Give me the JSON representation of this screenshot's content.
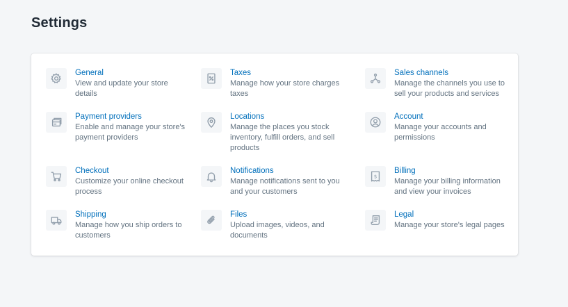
{
  "page": {
    "title": "Settings"
  },
  "settings": [
    {
      "key": "general",
      "title": "General",
      "description": "View and update your store details",
      "icon": "gear-icon"
    },
    {
      "key": "taxes",
      "title": "Taxes",
      "description": "Manage how your store charges taxes",
      "icon": "receipt-percent-icon"
    },
    {
      "key": "sales-channels",
      "title": "Sales channels",
      "description": "Manage the channels you use to sell your products and services",
      "icon": "channels-icon"
    },
    {
      "key": "payment-providers",
      "title": "Payment providers",
      "description": "Enable and manage your store's payment providers",
      "icon": "credit-card-icon"
    },
    {
      "key": "locations",
      "title": "Locations",
      "description": "Manage the places you stock inventory, fulfill orders, and sell products",
      "icon": "location-pin-icon"
    },
    {
      "key": "account",
      "title": "Account",
      "description": "Manage your accounts and permissions",
      "icon": "profile-icon"
    },
    {
      "key": "checkout",
      "title": "Checkout",
      "description": "Customize your online checkout process",
      "icon": "cart-icon"
    },
    {
      "key": "notifications",
      "title": "Notifications",
      "description": "Manage notifications sent to you and your customers",
      "icon": "bell-icon"
    },
    {
      "key": "billing",
      "title": "Billing",
      "description": "Manage your billing information and view your invoices",
      "icon": "invoice-dollar-icon"
    },
    {
      "key": "shipping",
      "title": "Shipping",
      "description": "Manage how you ship orders to customers",
      "icon": "truck-icon"
    },
    {
      "key": "files",
      "title": "Files",
      "description": "Upload images, videos, and documents",
      "icon": "paperclip-icon"
    },
    {
      "key": "legal",
      "title": "Legal",
      "description": "Manage your store's legal pages",
      "icon": "document-icon"
    }
  ],
  "colors": {
    "background": "#f4f6f8",
    "link": "#006fbb",
    "text_subdued": "#637381",
    "icon": "#919eab"
  }
}
